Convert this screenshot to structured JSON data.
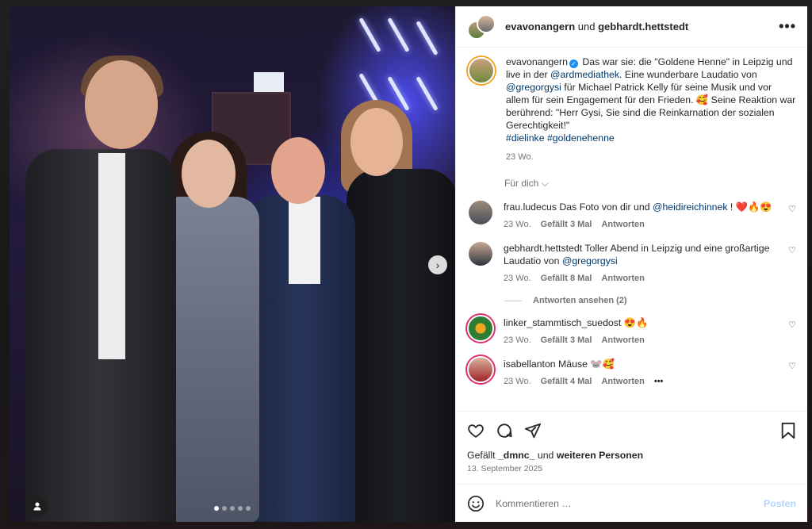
{
  "header": {
    "user1": "evavonangern",
    "joiner": "und",
    "user2": "gebhardt.hettstedt"
  },
  "caption": {
    "username": "evavonangern",
    "text_1": "Das war sie: die \"Goldene Henne\" in Leipzig und live in der ",
    "mention_1": "@ardmediathek",
    "text_2": ". Eine wunderbare Laudatio von ",
    "mention_2": "@gregorgysi",
    "text_3": " für Michael Patrick Kelly für seine Musik und vor allem für sein Engagement für den Frieden. 🥰 Seine Reaktion war berührend: \"Herr Gysi, Sie sind die Reinkarnation der sozialen Gerechtigkeit!\"",
    "hashtags": "#dielinke #goldenehenne",
    "age": "23 Wo."
  },
  "fuer_dich": "Für dich",
  "comments": [
    {
      "username": "frau.ludecus",
      "text": " Das Foto von dir und ",
      "mention": "@heidireichinnek",
      "text_after": " ! ❤️🔥😍",
      "age": "23 Wo.",
      "likes": "Gefällt 3 Mal",
      "reply": "Antworten"
    },
    {
      "username": "gebhardt.hettstedt",
      "text": " Toller Abend in Leipzig und eine großartige Laudatio von ",
      "mention": "@gregorgysi",
      "text_after": "",
      "age": "23 Wo.",
      "likes": "Gefällt 8 Mal",
      "reply": "Antworten"
    },
    {
      "username": "linker_stammtisch_suedost",
      "text": " 😍🔥",
      "mention": "",
      "text_after": "",
      "age": "23 Wo.",
      "likes": "Gefällt 3 Mal",
      "reply": "Antworten"
    },
    {
      "username": "isabellanton",
      "text": " Mäuse 🐭🥰",
      "mention": "",
      "text_after": "",
      "age": "23 Wo.",
      "likes": "Gefällt 4 Mal",
      "reply": "Antworten"
    }
  ],
  "view_replies": "Antworten ansehen (2)",
  "likes_line": {
    "prefix": "Gefällt ",
    "user": "_dmnc_",
    "middle": " und ",
    "rest": "weiteren Personen"
  },
  "post_date": "13. September 2025",
  "composer": {
    "placeholder": "Kommentieren …",
    "post_label": "Posten"
  },
  "carousel": {
    "total": 5,
    "current": 1
  },
  "icons": {
    "more": "more-icon",
    "heart": "heart-icon",
    "comment": "comment-icon",
    "share": "share-icon",
    "bookmark": "bookmark-icon",
    "emoji": "emoji-icon",
    "next": "chevron-right-icon",
    "tag": "user-tag-icon",
    "verified": "verified-icon"
  },
  "colors": {
    "link": "#00376b",
    "muted": "#737373",
    "post_disabled": "#b3d4fc",
    "verified": "#1f8ef1"
  }
}
